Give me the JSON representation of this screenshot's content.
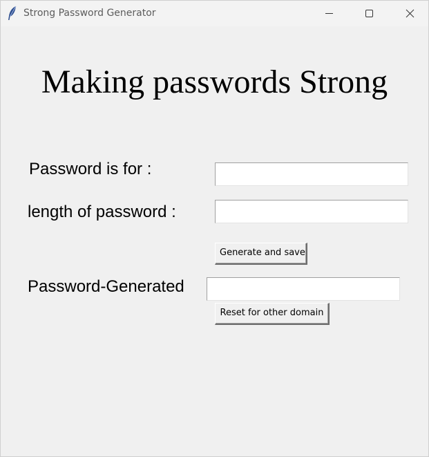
{
  "window": {
    "title": "Strong Password Generator",
    "icon": "feather-icon",
    "controls": [
      "minimize-icon",
      "maximize-icon",
      "close-icon"
    ]
  },
  "heading": "Making passwords Strong",
  "form": {
    "password_for_label": "Password is for :",
    "password_for_value": "",
    "length_label": "length of password :",
    "length_value": "",
    "generate_button": "Generate and save",
    "generated_label": "Password-Generated",
    "generated_value": "",
    "reset_button": "Reset for other domain"
  },
  "colors": {
    "background": "#f0f0f0",
    "titlebar": "#f3f3f3",
    "entry_background": "#ffffff",
    "text": "#000000"
  }
}
